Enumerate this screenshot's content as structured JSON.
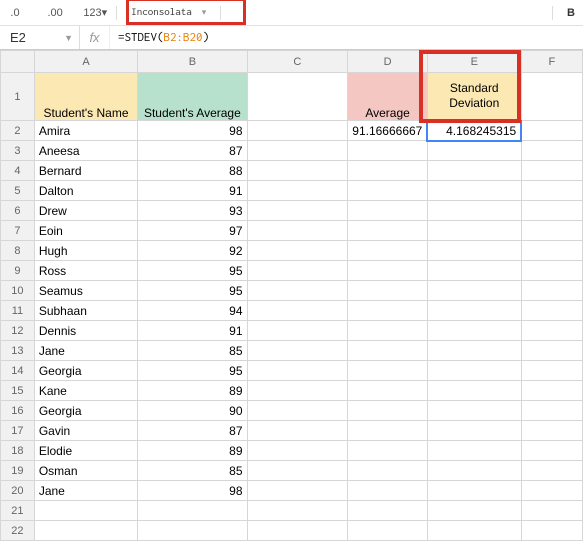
{
  "toolbar": {
    "dec0": ".0",
    "dec00": ".00",
    "numfmt": "123",
    "font": "Inconsolata",
    "bold": "B"
  },
  "namebox": {
    "cell": "E2",
    "fx": "fx"
  },
  "formula": {
    "prefix": "=STDEV(",
    "range": "B2:B20",
    "suffix": ")"
  },
  "cols": {
    "A": "A",
    "B": "B",
    "C": "C",
    "D": "D",
    "E": "E",
    "F": "F"
  },
  "headers": {
    "A": "Student's Name",
    "B": "Student's Average",
    "D": "Average",
    "E": "Standard\nDeviation"
  },
  "summary": {
    "avg": "91.16666667",
    "stdev": "4.168245315"
  },
  "chart_data": {
    "type": "table",
    "columns": [
      "Student's Name",
      "Student's Average"
    ],
    "rows": [
      [
        "Amira",
        98
      ],
      [
        "Aneesa",
        87
      ],
      [
        "Bernard",
        88
      ],
      [
        "Dalton",
        91
      ],
      [
        "Drew",
        93
      ],
      [
        "Eoin",
        97
      ],
      [
        "Hugh",
        92
      ],
      [
        "Ross",
        95
      ],
      [
        "Seamus",
        95
      ],
      [
        "Subhaan",
        94
      ],
      [
        "Dennis",
        91
      ],
      [
        "Jane",
        85
      ],
      [
        "Georgia",
        95
      ],
      [
        "Kane",
        89
      ],
      [
        "Georgia",
        90
      ],
      [
        "Gavin",
        87
      ],
      [
        "Elodie",
        89
      ],
      [
        "Osman",
        85
      ],
      [
        "Jane",
        98
      ]
    ]
  },
  "rownums": [
    "1",
    "2",
    "3",
    "4",
    "5",
    "6",
    "7",
    "8",
    "9",
    "10",
    "11",
    "12",
    "13",
    "14",
    "15",
    "16",
    "17",
    "18",
    "19",
    "20",
    "21",
    "22"
  ]
}
